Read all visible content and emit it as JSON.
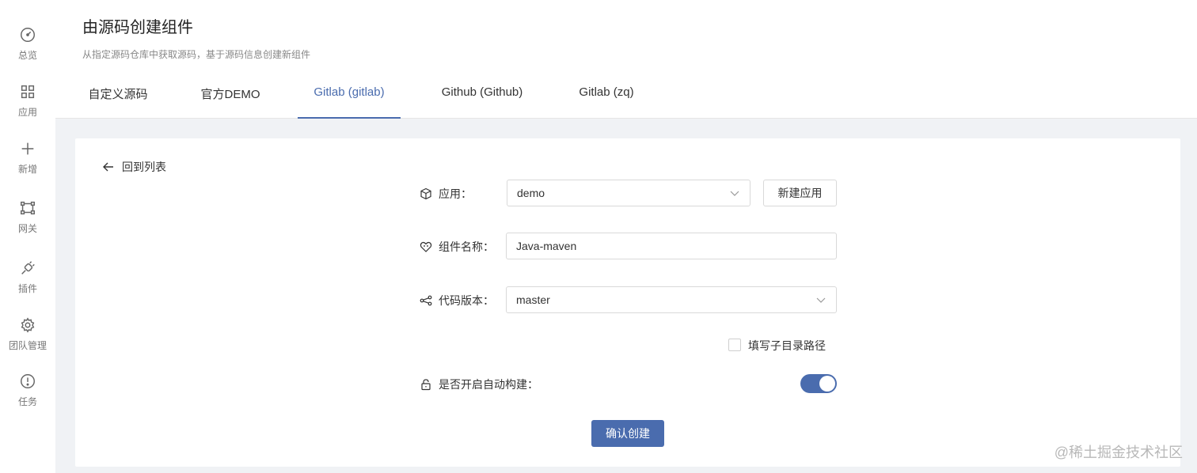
{
  "sidebar": {
    "items": [
      {
        "label": "总览",
        "icon": "dashboard-icon"
      },
      {
        "label": "应用",
        "icon": "apps-grid-icon"
      },
      {
        "label": "新增",
        "icon": "plus-icon"
      },
      {
        "label": "网关",
        "icon": "gateway-icon"
      },
      {
        "label": "插件",
        "icon": "plugin-icon"
      },
      {
        "label": "团队管理",
        "icon": "gear-icon"
      },
      {
        "label": "任务",
        "icon": "alert-circle-icon"
      }
    ]
  },
  "header": {
    "title": "由源码创建组件",
    "subtitle": "从指定源码仓库中获取源码，基于源码信息创建新组件",
    "tabs": [
      {
        "label": "自定义源码",
        "active": false
      },
      {
        "label": "官方DEMO",
        "active": false
      },
      {
        "label": "Gitlab (gitlab)",
        "active": true
      },
      {
        "label": "Github (Github)",
        "active": false
      },
      {
        "label": "Gitlab (zq)",
        "active": false
      }
    ]
  },
  "form": {
    "back_label": "回到列表",
    "app_label": "应用：",
    "app_value": "demo",
    "new_app_button": "新建应用",
    "component_name_label": "组件名称：",
    "component_name_value": "Java-maven",
    "code_version_label": "代码版本：",
    "code_version_value": "master",
    "subdir_checkbox_label": "填写子目录路径",
    "subdir_checked": false,
    "auto_build_label": "是否开启自动构建：",
    "auto_build_enabled": true,
    "submit_button": "确认创建"
  },
  "watermark": "@稀土掘金技术社区",
  "colors": {
    "accent": "#4a6cae",
    "background": "#f0f2f5"
  }
}
